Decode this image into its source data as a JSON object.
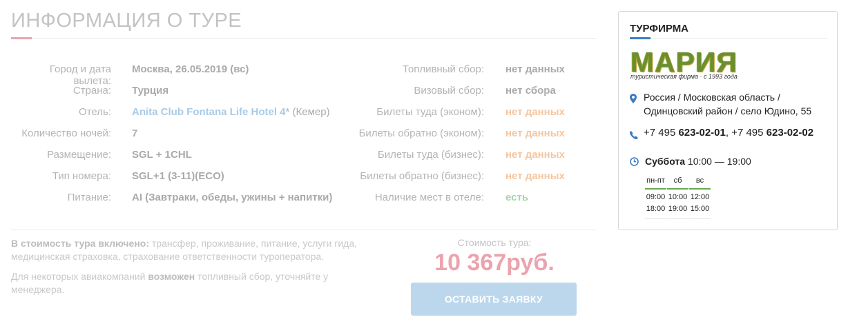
{
  "tour": {
    "title": "Информация о туре",
    "left_rows": [
      {
        "label": "Город и дата вылета:",
        "value": "Москва, 26.05.2019 (вс)"
      },
      {
        "label": "Страна:",
        "value": "Турция"
      },
      {
        "label": "Отель:",
        "value": "Anita Club Fontana Life Hotel 4*",
        "extra": "(Кемер)"
      },
      {
        "label": "Количество ночей:",
        "value": "7"
      },
      {
        "label": "Размещение:",
        "value": "SGL + 1CHL"
      },
      {
        "label": "Тип номера:",
        "value": "SGL+1 (3-11)(ECO)"
      },
      {
        "label": "Питание:",
        "value": "AI (Завтраки, обеды, ужины + напитки)"
      }
    ],
    "right_rows": [
      {
        "label": "Топливный сбор:",
        "value": "нет данных"
      },
      {
        "label": "Визовый сбор:",
        "value": "нет сбора"
      },
      {
        "label": "Билеты туда (эконом):",
        "value": "нет данных"
      },
      {
        "label": "Билеты обратно (эконом):",
        "value": "нет данных"
      },
      {
        "label": "Билеты туда (бизнес):",
        "value": "нет данных"
      },
      {
        "label": "Билеты обратно (бизнес):",
        "value": "нет данных"
      },
      {
        "label": "Наличие мест в отеле:",
        "value": "есть"
      }
    ],
    "included_label": "В стоимость тура включено:",
    "included_text": " трансфер, проживание, питание, услуги гида, медицинская страховка, страхование ответственности туроператора.",
    "fuel_note_pre": "Для некоторых авиакомпаний ",
    "fuel_note_bold": "возможен",
    "fuel_note_post": " топливный сбор, уточняйте у менеджера.",
    "price_label": "Стоимость тура:",
    "price": "10 367руб.",
    "order_button": "ОСТАВИТЬ ЗАЯВКУ"
  },
  "agency": {
    "title": "ТУРФИРМА",
    "logo_word": "МАРИЯ",
    "logo_sub": "туристическая фирма · с 1993 года",
    "address": "Россия / Московская область / Одинцовский район / село Юдино, 55",
    "phone1_prefix": "+7 495 ",
    "phone1_number": "623-02-01",
    "phone_sep": ", +7 495 ",
    "phone2_number": "623-02-02",
    "today_day": "Суббота",
    "today_hours": " 10:00 — 19:00",
    "hours": [
      {
        "day": "пн-пт",
        "open": "09:00",
        "close": "18:00"
      },
      {
        "day": "сб",
        "open": "10:00",
        "close": "19:00"
      },
      {
        "day": "вс",
        "open": "12:00",
        "close": "15:00"
      }
    ]
  },
  "colors": {
    "accent_pink": "#e8a3ad",
    "accent_blue": "#3b7bc4",
    "price": "#eba3ad",
    "button": "#bcd7ec",
    "no_data_orange": "#f5c6a0",
    "available_green": "#a8d4ae"
  },
  "icons": [
    "map-pin-icon",
    "phone-icon",
    "clock-icon"
  ]
}
